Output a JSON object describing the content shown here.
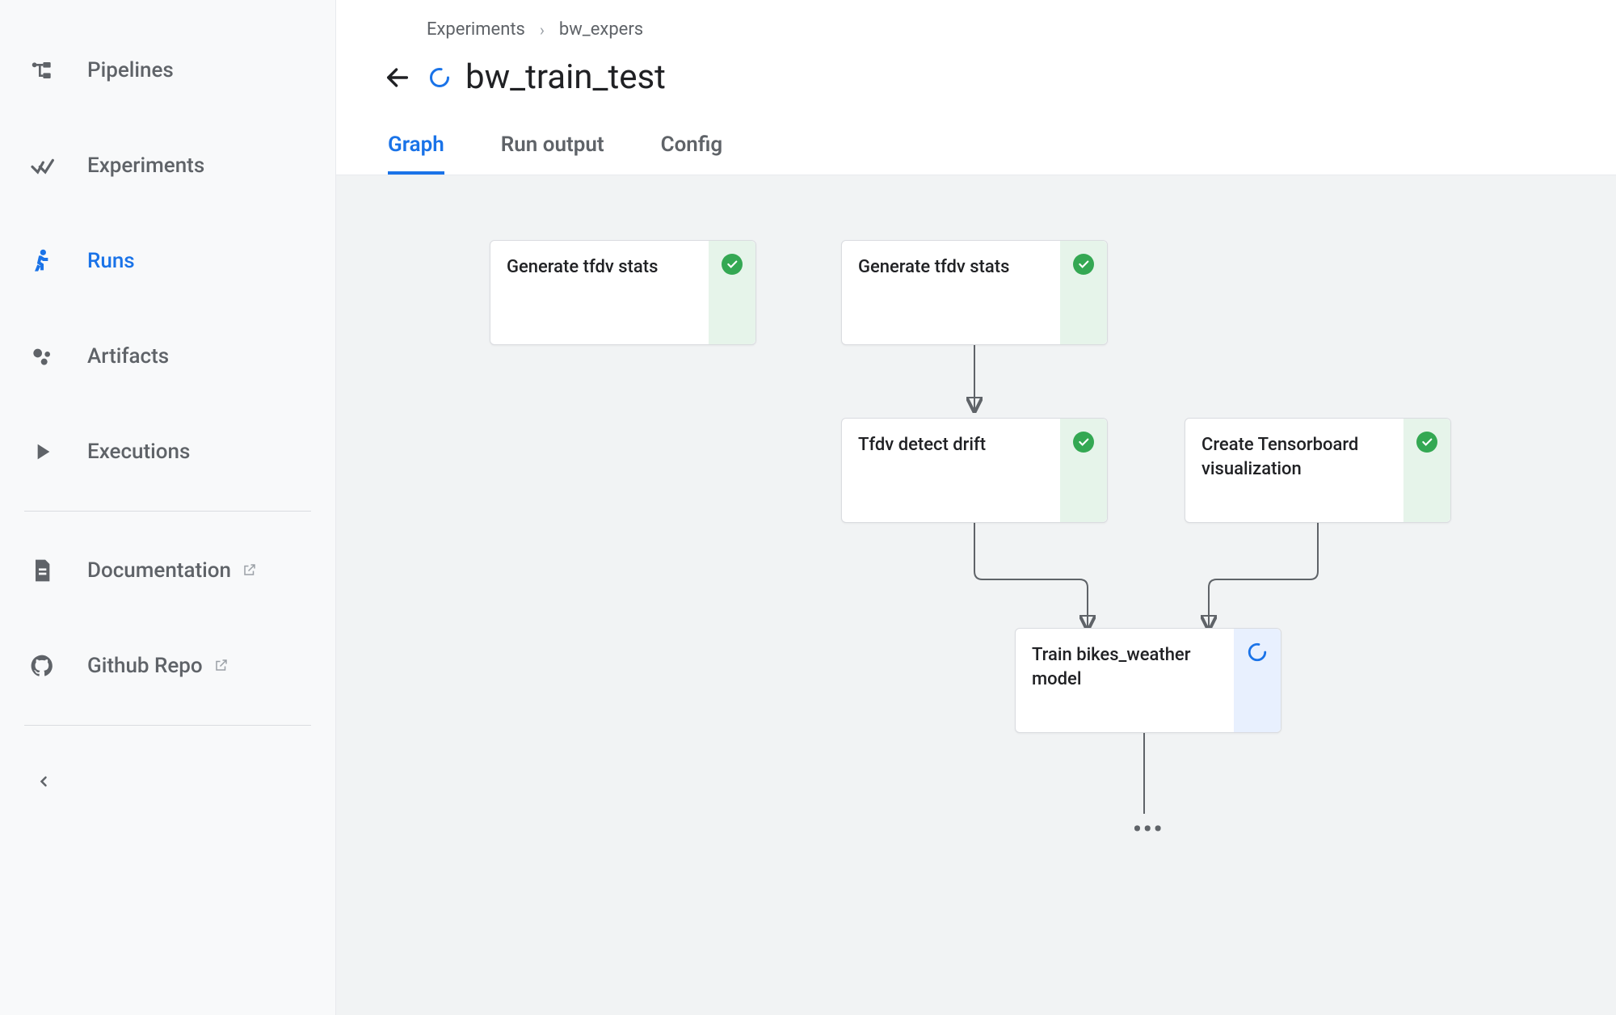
{
  "sidebar": {
    "items": [
      {
        "label": "Pipelines",
        "icon": "pipelines-icon"
      },
      {
        "label": "Experiments",
        "icon": "experiments-icon"
      },
      {
        "label": "Runs",
        "icon": "runs-icon",
        "active": true
      },
      {
        "label": "Artifacts",
        "icon": "artifacts-icon"
      },
      {
        "label": "Executions",
        "icon": "executions-icon"
      }
    ],
    "secondary": [
      {
        "label": "Documentation",
        "icon": "documentation-icon",
        "external": true
      },
      {
        "label": "Github Repo",
        "icon": "github-icon",
        "external": true
      }
    ]
  },
  "breadcrumb": {
    "root": "Experiments",
    "child": "bw_expers"
  },
  "page": {
    "title": "bw_train_test",
    "status": "running"
  },
  "tabs": [
    {
      "label": "Graph",
      "active": true
    },
    {
      "label": "Run output"
    },
    {
      "label": "Config"
    }
  ],
  "graph": {
    "nodes": [
      {
        "id": "gen1",
        "label": "Generate tfdv stats",
        "status": "success"
      },
      {
        "id": "gen2",
        "label": "Generate tfdv stats",
        "status": "success"
      },
      {
        "id": "drift",
        "label": "Tfdv detect drift",
        "status": "success"
      },
      {
        "id": "tb",
        "label": "Create Tensorboard visualization",
        "status": "success"
      },
      {
        "id": "train",
        "label": "Train bikes_weather model",
        "status": "running"
      }
    ]
  }
}
